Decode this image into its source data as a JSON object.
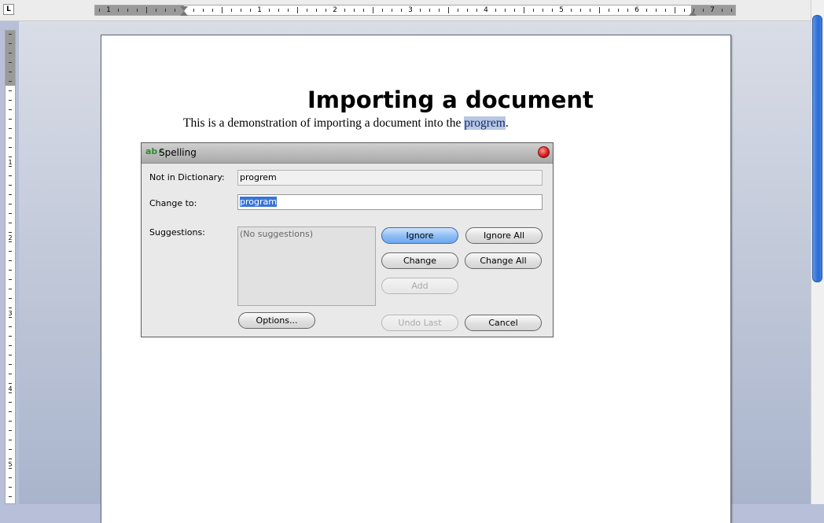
{
  "rulers": {
    "horizontal_numbers": [
      "1",
      "1",
      "2",
      "3",
      "4",
      "5",
      "6",
      "7"
    ],
    "vertical_numbers": [
      "1",
      "2",
      "3",
      "4",
      "5"
    ],
    "tab_selector": "L"
  },
  "document": {
    "title": "Importing a document",
    "para_before": "This is a demonstration of importing a document into the ",
    "misspelled_word": "progrem",
    "para_after": "."
  },
  "dialog": {
    "title": "Spelling",
    "not_in_dictionary_label": "Not in Dictionary:",
    "not_in_dictionary_value": "progrem",
    "change_to_label": "Change to:",
    "change_to_value": "program",
    "suggestions_label": "Suggestions:",
    "suggestions_empty": "(No suggestions)",
    "buttons": {
      "ignore": "Ignore",
      "ignore_all": "Ignore All",
      "change": "Change",
      "change_all": "Change All",
      "add": "Add",
      "options": "Options...",
      "undo_last": "Undo Last",
      "cancel": "Cancel"
    }
  },
  "colors": {
    "selection": "#3874d8",
    "misspelled_highlight": "#b8c8e4",
    "close_button": "#d81414"
  }
}
